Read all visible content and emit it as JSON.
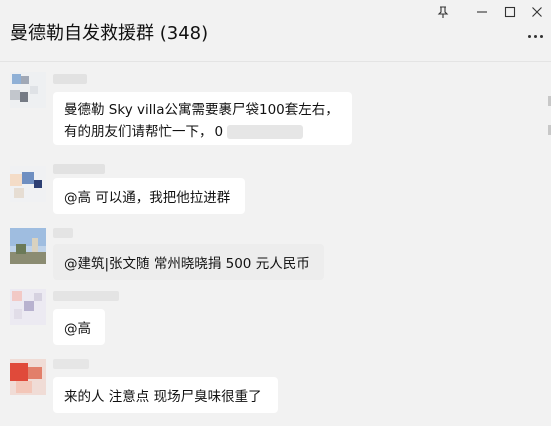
{
  "window": {
    "title": "曼德勒自发救援群 (348)",
    "controls": {
      "pin_icon": "pin-icon",
      "minimize_icon": "minimize-icon",
      "maximize_icon": "maximize-icon",
      "close_icon": "close-icon"
    },
    "more_icon": "more-options-icon"
  },
  "messages": [
    {
      "lines": [
        "曼德勒 Sky villa公寓需要裹尸袋100套左右，",
        "有的朋友们请帮忙一下，"
      ],
      "redacted_tail": "0"
    },
    {
      "text": "@高 可以通，我把他拉进群"
    },
    {
      "text": "@建筑|张文随 常州晓晓捐 500 元人民币"
    },
    {
      "text": "@高"
    },
    {
      "text": "来的人 注意点 现场尸臭味很重了"
    }
  ],
  "colors": {
    "background": "#f2f2f2",
    "bubble": "#ffffff",
    "bubble_highlight": "#ededed"
  }
}
